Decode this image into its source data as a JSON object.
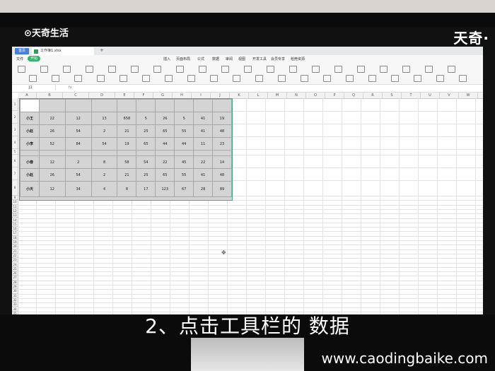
{
  "watermark_left": "⊙天奇生活",
  "watermark_right": "天奇·",
  "caption": "2、点击工具栏的 数据",
  "site_url": "www.caodingbaike.com",
  "tabs": {
    "home": "首页",
    "doc": "工作簿1.xlsx",
    "plus": "+"
  },
  "menu": [
    "文件",
    "开始",
    "插入",
    "页面布局",
    "公式",
    "数据",
    "审阅",
    "视图",
    "开发工具",
    "会员专享",
    "稻壳资源"
  ],
  "menu_active": "开始",
  "namebox": "J1",
  "fx": "fx",
  "columns": [
    "A",
    "B",
    "C",
    "D",
    "E",
    "F",
    "G",
    "H",
    "I",
    "J",
    "K",
    "L",
    "M",
    "N",
    "O",
    "P",
    "Q",
    "R",
    "S",
    "T",
    "U",
    "V",
    "W"
  ],
  "rows": [
    "1",
    "2",
    "3",
    "4",
    "5",
    "6",
    "7",
    "8",
    "9",
    "10",
    "11",
    "12",
    "13",
    "14",
    "15",
    "16",
    "17",
    "18",
    "19",
    "20",
    "21",
    "22",
    "23",
    "24",
    "25",
    "26",
    "27",
    "28",
    "29",
    "30",
    "31",
    "32",
    "33",
    "34",
    "35",
    "36"
  ],
  "table": [
    {
      "label": "",
      "values": [
        "",
        "",
        "",
        "",
        "",
        "",
        "",
        "",
        ""
      ]
    },
    {
      "label": "小王",
      "values": [
        "22",
        "12",
        "13",
        "658",
        "5",
        "26",
        "5",
        "41",
        "19"
      ]
    },
    {
      "label": "小赵",
      "values": [
        "26",
        "54",
        "2",
        "21",
        "25",
        "65",
        "55",
        "41",
        "48"
      ]
    },
    {
      "label": "小李",
      "values": [
        "52",
        "84",
        "54",
        "19",
        "65",
        "44",
        "44",
        "11",
        "23"
      ]
    },
    {
      "label": "",
      "values": [
        "",
        "",
        "",
        "",
        "",
        "",
        "",
        "",
        ""
      ]
    },
    {
      "label": "小春",
      "values": [
        "12",
        "2",
        "8",
        "58",
        "54",
        "22",
        "45",
        "22",
        "14"
      ]
    },
    {
      "label": "小赵",
      "values": [
        "26",
        "54",
        "2",
        "21",
        "25",
        "65",
        "55",
        "41",
        "48"
      ]
    },
    {
      "label": "小天",
      "values": [
        "12",
        "34",
        "4",
        "8",
        "17",
        "123",
        "67",
        "28",
        "89"
      ]
    }
  ]
}
